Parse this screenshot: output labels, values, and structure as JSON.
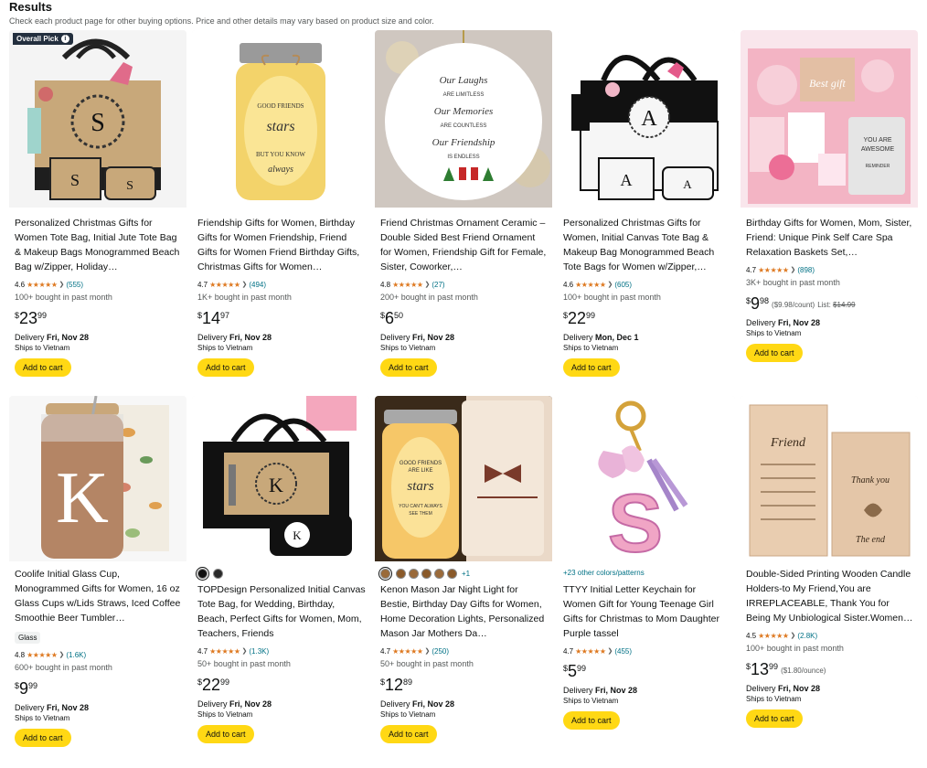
{
  "header": {
    "title": "Results",
    "subtitle": "Check each product page for other buying options. Price and other details may vary based on product size and color."
  },
  "common": {
    "add_to_cart": "Add to cart",
    "ships": "Ships to Vietnam",
    "delivery_prefix": "Delivery ",
    "currency": "$",
    "overall_pick": "Overall Pick",
    "info_glyph": "i",
    "chevron": "❯"
  },
  "products": [
    {
      "title": "Personalized Christmas Gifts for Women Tote Bag, Initial Jute Tote Bag & Makeup Bags Monogrammed Beach Bag w/Zipper, Holiday…",
      "rating": "4.6",
      "stars": "★★★★★",
      "reviews": "(555)",
      "bought": "100+ bought in past month",
      "price_whole": "23",
      "price_frac": "99",
      "delivery_date": "Fri, Nov 28"
    },
    {
      "title": "Friendship Gifts for Women, Birthday Gifts for Women Friendship, Friend Gifts for Women Friend Birthday Gifts, Christmas Gifts for Women…",
      "rating": "4.7",
      "stars": "★★★★★",
      "reviews": "(494)",
      "bought": "1K+ bought in past month",
      "price_whole": "14",
      "price_frac": "97",
      "delivery_date": "Fri, Nov 28"
    },
    {
      "title": "Friend Christmas Ornament Ceramic – Double Sided Best Friend Ornament for Women, Friendship Gift for Female, Sister, Coworker,…",
      "rating": "4.8",
      "stars": "★★★★★",
      "reviews": "(27)",
      "bought": "200+ bought in past month",
      "price_whole": "6",
      "price_frac": "50",
      "delivery_date": "Fri, Nov 28",
      "image_text": [
        "Our Laughs",
        "ARE LIMITLESS",
        "Our Memories",
        "ARE COUNTLESS",
        "Our Friendship",
        "IS ENDLESS"
      ]
    },
    {
      "title": "Personalized Christmas Gifts for Women, Initial Canvas Tote Bag & Makeup Bag Monogrammed Beach Tote Bags for Women w/Zipper,…",
      "rating": "4.6",
      "stars": "★★★★★",
      "reviews": "(605)",
      "bought": "100+ bought in past month",
      "price_whole": "22",
      "price_frac": "99",
      "delivery_date": "Mon, Dec 1"
    },
    {
      "title": "Birthday Gifts for Women, Mom, Sister, Friend: Unique Pink Self Care Spa Relaxation Baskets Set,…",
      "rating": "4.7",
      "stars": "★★★★★",
      "reviews": "(898)",
      "bought": "3K+ bought in past month",
      "price_whole": "9",
      "price_frac": "98",
      "unit_price": "($9.98/count)",
      "list_label": "List:",
      "list_price": "$14.99",
      "delivery_date": "Fri, Nov 28",
      "image_text": [
        "Best gift",
        "YOU ARE",
        "AWESOME",
        "REMINDER"
      ]
    },
    {
      "title": "Coolife Initial Glass Cup, Monogrammed Gifts for Women, 16 oz Glass Cups w/Lids Straws, Iced Coffee Smoothie Beer Tumbler…",
      "chip": "Glass",
      "rating": "4.8",
      "stars": "★★★★★",
      "reviews": "(1.6K)",
      "bought": "600+ bought in past month",
      "price_whole": "9",
      "price_frac": "99",
      "delivery_date": "Fri, Nov 28",
      "image_text": [
        "K"
      ]
    },
    {
      "title": "TOPDesign Personalized Initial Canvas Tote Bag, for Wedding, Birthday, Beach, Perfect Gifts for Women, Mom, Teachers, Friends",
      "rating": "4.7",
      "stars": "★★★★★",
      "reviews": "(1.3K)",
      "bought": "50+ bought in past month",
      "price_whole": "22",
      "price_frac": "99",
      "delivery_date": "Fri, Nov 28"
    },
    {
      "title": "Kenon Mason Jar Night Light for Bestie, Birthday Day Gifts for Women, Home Decoration Lights, Personalized Mason Jar Mothers Da…",
      "more_colors": "+1",
      "rating": "4.7",
      "stars": "★★★★★",
      "reviews": "(250)",
      "bought": "50+ bought in past month",
      "price_whole": "12",
      "price_frac": "89",
      "delivery_date": "Fri, Nov 28"
    },
    {
      "title": "TTYY Initial Letter Keychain for Women Gift for Young Teenage Girl Gifts for Christmas to Mom Daughter Purple tassel",
      "colors_link": "+23 other colors/patterns",
      "rating": "4.7",
      "stars": "★★★★★",
      "reviews": "(455)",
      "price_whole": "5",
      "price_frac": "99",
      "delivery_date": "Fri, Nov 28",
      "image_text": [
        "S"
      ]
    },
    {
      "title": "Double-Sided Printing Wooden Candle Holders-to My Friend,You are IRREPLACEABLE, Thank You for Being My Unbiological Sister.Women…",
      "rating": "4.5",
      "stars": "★★★★★",
      "reviews": "(2.8K)",
      "bought": "100+ bought in past month",
      "price_whole": "13",
      "price_frac": "99",
      "unit_price": "($1.80/ounce)",
      "delivery_date": "Fri, Nov 28",
      "image_text": [
        "Friend",
        "Thank you",
        "The end"
      ]
    }
  ],
  "colors": {
    "cart_button": "#ffd814",
    "stars": "#de7921",
    "link": "#007185",
    "badge": "#232f3e"
  }
}
